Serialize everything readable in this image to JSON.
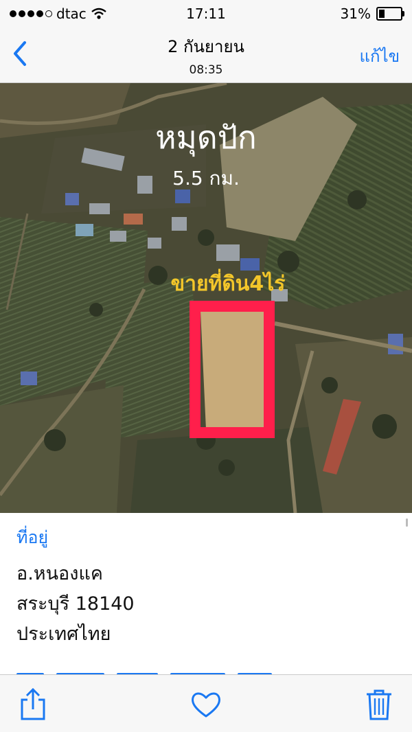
{
  "status_bar": {
    "carrier": "dtac",
    "signal_bars_filled": 4,
    "signal_bars_total": 5,
    "time": "17:11",
    "battery_percent_label": "31%",
    "battery_level": 0.31
  },
  "nav": {
    "back_icon": "chevron-left-icon",
    "title": "2 กันยายน",
    "subtitle": "08:35",
    "edit_label": "แก้ไข"
  },
  "photo": {
    "overlay_title": "หมุดปัก",
    "overlay_distance": "5.5 กม.",
    "overlay_sale_text": "ขายที่ดิน4ไร่",
    "marker_color": "#ff1f4b",
    "sale_text_color": "#f3c62a"
  },
  "info": {
    "address_label": "ที่อยู่",
    "address_line1": "อ.หนองแค",
    "address_line2": "สระบุรี 18140",
    "address_line3": "ประเทศไทย"
  },
  "toolbar": {
    "share_icon": "share-icon",
    "favorite_icon": "heart-icon",
    "delete_icon": "trash-icon"
  },
  "colors": {
    "ios_blue": "#1a78f2"
  }
}
